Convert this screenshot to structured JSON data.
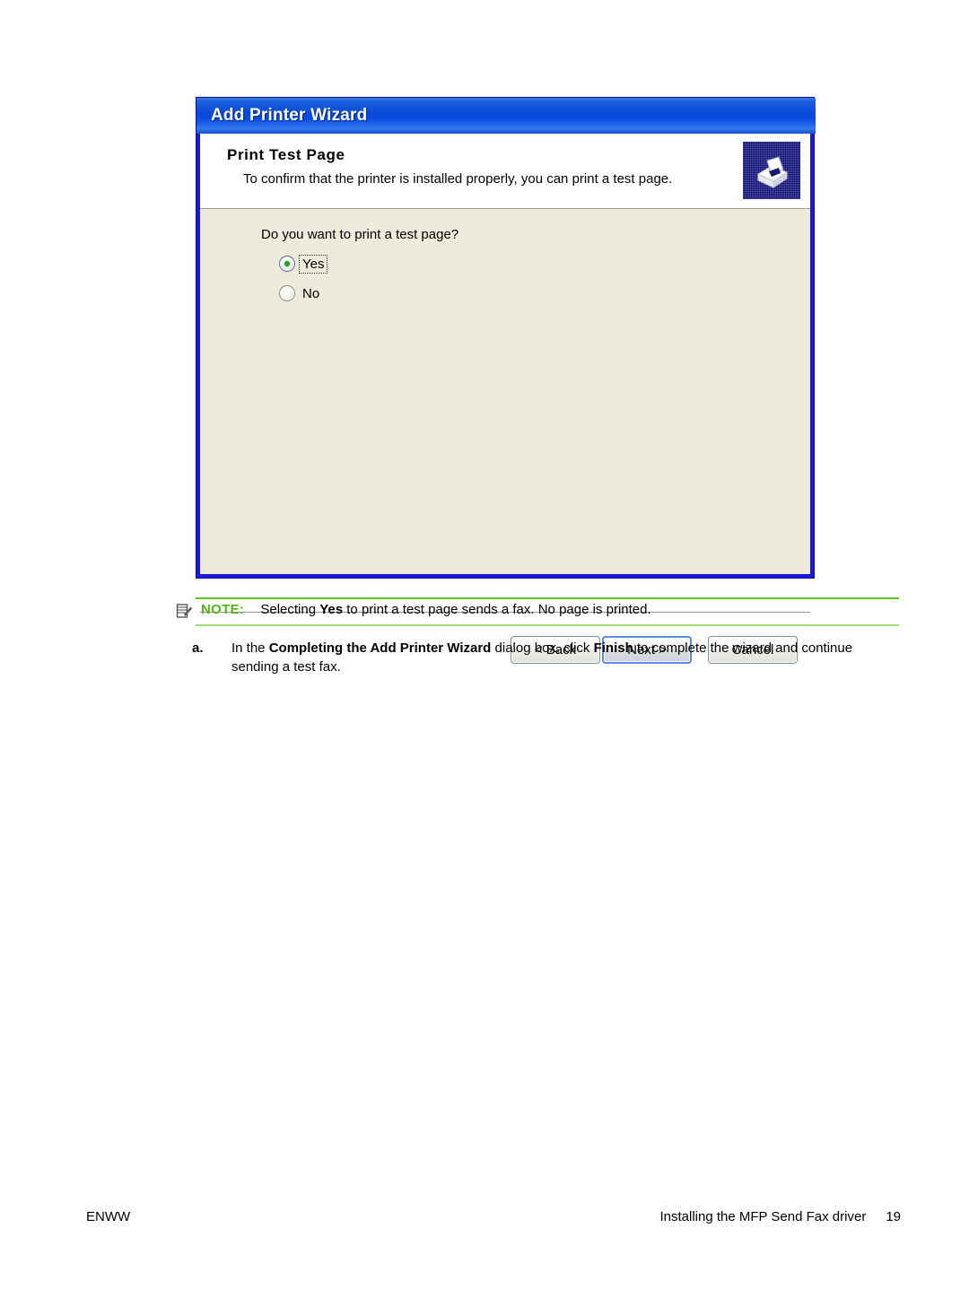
{
  "dialog": {
    "title": "Add Printer Wizard",
    "header": {
      "heading": "Print Test Page",
      "subheading": "To confirm that the printer is installed properly, you can print a test page.",
      "icon": "printer-icon"
    },
    "question": "Do you want to print a test page?",
    "options": [
      {
        "label": "Yes",
        "selected": true,
        "focused": true
      },
      {
        "label": "No",
        "selected": false,
        "focused": false
      }
    ],
    "buttons": [
      {
        "label": "< Back",
        "default": false
      },
      {
        "label": "Next >",
        "default": true
      },
      {
        "label": "Cancel",
        "default": false
      }
    ]
  },
  "note": {
    "icon": "note-pencil-icon",
    "label": "NOTE:",
    "text_before": "Selecting ",
    "emphasis": "Yes",
    "text_after": " to print a test page sends a fax. No page is printed.",
    "rule_color_top": "#5dc21e",
    "rule_color_bottom": "#9edd72",
    "label_color": "#55b319"
  },
  "step": {
    "marker": "a.",
    "part1": "In the ",
    "bold1": "Completing the Add Printer Wizard",
    "part2": " dialog box, click ",
    "bold2": "Finish",
    "part3": " to complete the wizard and continue sending a test fax."
  },
  "footer": {
    "left": "ENWW",
    "right": "Installing the MFP Send Fax driver",
    "page": "19"
  }
}
